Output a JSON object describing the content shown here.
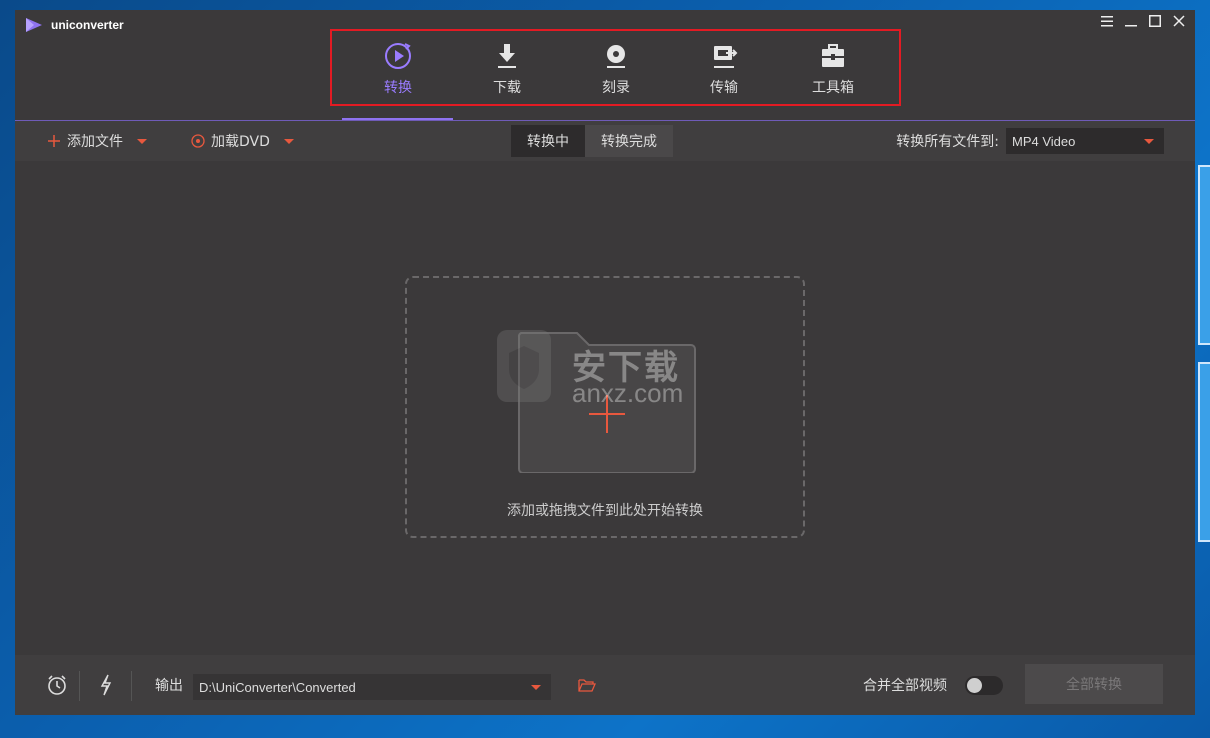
{
  "app": {
    "name": "uniconverter"
  },
  "nav": {
    "items": [
      {
        "label": "转换",
        "icon": "convert-icon",
        "active": true
      },
      {
        "label": "下载",
        "icon": "download-icon",
        "active": false
      },
      {
        "label": "刻录",
        "icon": "burn-icon",
        "active": false
      },
      {
        "label": "传输",
        "icon": "transfer-icon",
        "active": false
      },
      {
        "label": "工具箱",
        "icon": "toolbox-icon",
        "active": false
      }
    ]
  },
  "toolbar": {
    "add_files_label": "添加文件",
    "load_dvd_label": "加载DVD",
    "tabs": [
      {
        "label": "转换中",
        "active": true
      },
      {
        "label": "转换完成",
        "active": false
      }
    ],
    "convert_all_to_label": "转换所有文件到:",
    "format_value": "MP4 Video"
  },
  "dropzone": {
    "text": "添加或拖拽文件到此处开始转换",
    "watermark_text": "安下载",
    "watermark_url": "anxz.com"
  },
  "footer": {
    "output_label": "输出",
    "output_path": "D:\\UniConverter\\Converted",
    "merge_label": "合并全部视频",
    "merge_on": false,
    "convert_all_button": "全部转换"
  },
  "colors": {
    "accent": "#9a7cff",
    "highlight_box": "#e31b23",
    "orange": "#e8583e"
  }
}
